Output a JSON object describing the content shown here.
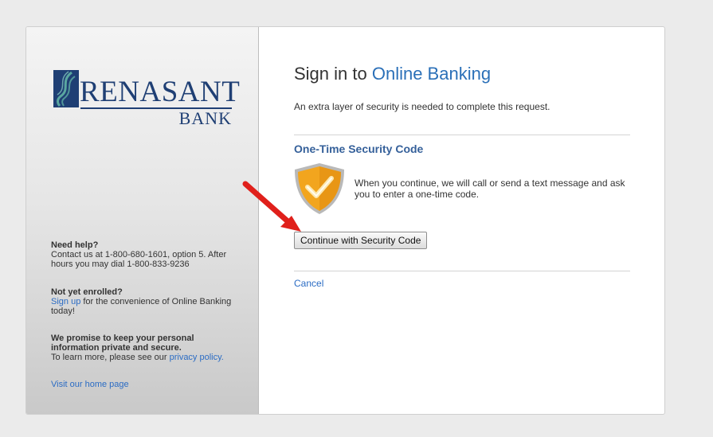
{
  "brand": {
    "name": "RENASANT",
    "sub": "BANK",
    "primary_color": "#1f3f74",
    "accent_color": "#5aa7a0"
  },
  "sidebar": {
    "help_title": "Need help?",
    "help_text": "Contact us at 1-800-680-1601, option 5. After hours you may dial 1-800-833-9236",
    "enroll_title": "Not yet enrolled?",
    "enroll_link": "Sign up",
    "enroll_text": " for the convenience of Online Banking today!",
    "privacy_title": "We promise to keep your personal information private and secure.",
    "privacy_text": "To learn more, please see our ",
    "privacy_link": "privacy policy.",
    "home_link": "Visit our home page"
  },
  "main": {
    "title_prefix": "Sign in to ",
    "title_accent": "Online Banking",
    "subtitle": "An extra layer of security is needed to complete this request.",
    "section_title": "One-Time Security Code",
    "shield_icon": "shield-check-icon",
    "description": "When you continue, we will call or send a text message and ask you to enter a one-time code.",
    "continue_button": "Continue with Security Code",
    "cancel_link": "Cancel"
  },
  "annotation": {
    "arrow_icon": "red-arrow-icon",
    "arrow_color": "#e0201b"
  },
  "colors": {
    "link": "#2b6cc4",
    "title_accent": "#2b70b8",
    "section_title": "#35609a",
    "shield_gold": "#f2a51e"
  }
}
